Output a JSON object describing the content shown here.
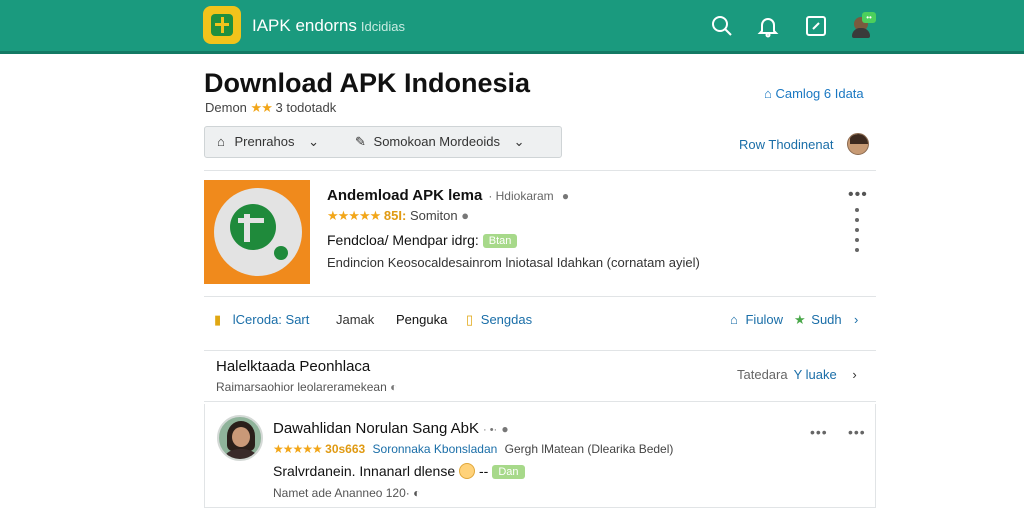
{
  "colors": {
    "header": "#1a9a7e",
    "accent": "#1a6ea8",
    "star": "#f2a619",
    "tag": "#a7d98a",
    "app_icon_bg": "#f08a1c"
  },
  "header": {
    "brand": "IAPK endorns",
    "brand_sub": "Idcidias",
    "icons": [
      "search-icon",
      "bell-icon",
      "share-icon",
      "profile-avatar"
    ],
    "badge": "••"
  },
  "page": {
    "title": "Download APK Indonesia",
    "subline_prefix": "Demon",
    "subline_stars": "★★",
    "subline_suffix": "3 todotadk",
    "catalog_link": "Camlog 6 Idata"
  },
  "filters": {
    "first": "Prenrahos",
    "second": "Somokoan Mordeoids",
    "right_link": "Row Thodinenat"
  },
  "app": {
    "name": "Andemload APK lema",
    "developer": "· Hdiokaram",
    "stars": "★★★★★",
    "rating": "85I:",
    "rating_label": "Somiton",
    "line3": "Fendcloa/ Mendpar idrg:",
    "tag": "Btan",
    "description": "Endincion Keosocaldesainrom lniotasal Idahkan (cornatam ayiel)",
    "more": "•••"
  },
  "actions": {
    "item1": "lCeroda: Sart",
    "item2": "Jamak",
    "item3": "Penguka",
    "item4": "Sengdas",
    "follow": "Fiulow",
    "star_label": "Sudh"
  },
  "info": {
    "title": "Halelktaada Peonhlaca",
    "subtitle": "Raimarsaohior leolareramekean",
    "right_label": "Tatedara",
    "right_link": "Y luake"
  },
  "review": {
    "title": "Dawahlidan Norulan Sang AbK",
    "meta": "· •·",
    "stars": "★★★★★",
    "rating": "30s663",
    "rating_link": "Soronnaka Kbonsladan",
    "rating_rest": "Gergh lMatean (Dlearika Bedel)",
    "text": "Sralvrdanein. Innanarl dlense",
    "text_suffix": "--",
    "tag": "Dan",
    "footer": "Namet ade Ananneo 120·"
  }
}
